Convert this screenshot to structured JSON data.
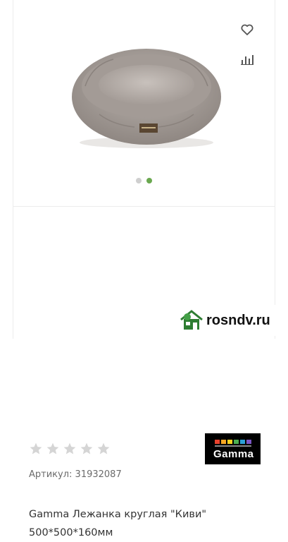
{
  "product": {
    "title_line1": "Gamma Лежанка круглая \"Киви\"",
    "title_line2": "500*500*160мм",
    "article_label": "Артикул:",
    "article_number": "31932087",
    "rating_stars_filled": 0,
    "rating_stars_total": 5
  },
  "gallery": {
    "slides_total": 2,
    "active_slide": 2
  },
  "brand": {
    "logo_text": "Gamma"
  },
  "icons": {
    "favorite": "heart-icon",
    "compare": "bar-chart-icon",
    "star": "star-icon"
  },
  "watermark": {
    "text": "rosndv.ru"
  },
  "colors": {
    "active_dot": "#6aa84f",
    "inactive_dot": "#cfcfcf",
    "star_empty": "#d5d5d5",
    "logo_bg": "#000000"
  }
}
